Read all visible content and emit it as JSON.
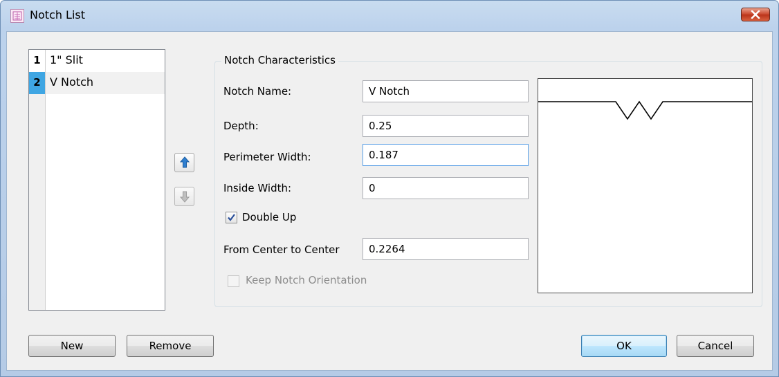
{
  "window": {
    "title": "Notch List",
    "app_icon": "notch-app-icon",
    "close_icon": "close-x-icon"
  },
  "notch_list": {
    "rows": [
      {
        "index": "1",
        "name": "1\" Slit"
      },
      {
        "index": "2",
        "name": "V Notch",
        "selected": true
      }
    ]
  },
  "move_buttons": {
    "up_icon": "arrow-up-icon",
    "down_icon": "arrow-down-icon"
  },
  "characteristics": {
    "group_title": "Notch Characteristics",
    "notch_name": {
      "label": "Notch Name:",
      "value": "V Notch"
    },
    "depth": {
      "label": "Depth:",
      "value": "0.25"
    },
    "perimeter_width": {
      "label": "Perimeter Width:",
      "value": "0.187"
    },
    "inside_width": {
      "label": "Inside Width:",
      "value": "0"
    },
    "double_up": {
      "label": "Double Up",
      "checked": true
    },
    "center_to_center": {
      "label": "From Center to Center",
      "value": "0.2264"
    },
    "keep_orientation": {
      "label": "Keep Notch Orientation",
      "checked": false,
      "disabled": true
    }
  },
  "buttons": {
    "new": "New",
    "remove": "Remove",
    "ok": "OK",
    "cancel": "Cancel"
  },
  "colors": {
    "selection": "#3fa6e3",
    "title_bar": "#bcd2ec",
    "up_arrow": "#2f7fd0",
    "down_arrow": "#a0a0a0"
  }
}
